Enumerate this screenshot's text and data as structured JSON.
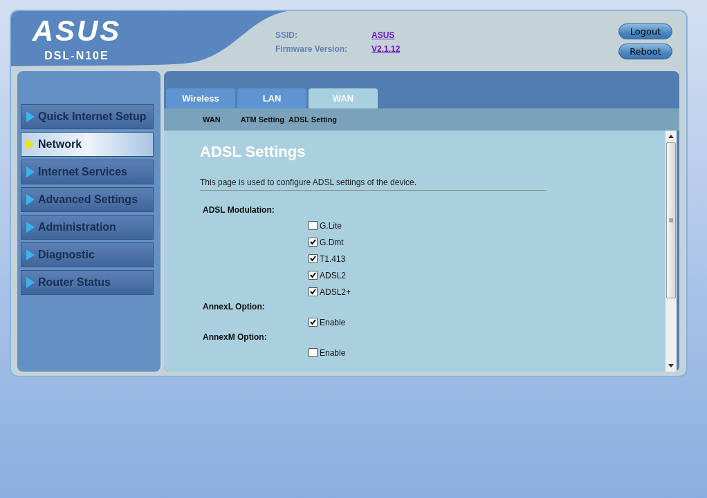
{
  "header": {
    "logo": "ASUS",
    "model": "DSL-N10E",
    "info": [
      {
        "label": "SSID:",
        "value": "ASUS"
      },
      {
        "label": "Firmware Version:",
        "value": "V2.1.12"
      }
    ],
    "buttons": [
      "Logout",
      "Reboot"
    ]
  },
  "sidebar": {
    "items": [
      {
        "label": "Quick Internet Setup",
        "selected": false
      },
      {
        "label": "Network",
        "selected": true
      },
      {
        "label": "Internet Services",
        "selected": false
      },
      {
        "label": "Advanced Settings",
        "selected": false
      },
      {
        "label": "Administration",
        "selected": false
      },
      {
        "label": "Diagnostic",
        "selected": false
      },
      {
        "label": "Router Status",
        "selected": false
      }
    ]
  },
  "tabs": [
    {
      "label": "Wireless",
      "selected": false
    },
    {
      "label": "LAN",
      "selected": false
    },
    {
      "label": "WAN",
      "selected": true
    }
  ],
  "subnav": [
    "WAN",
    "ATM Setting",
    "ADSL Setting"
  ],
  "content": {
    "title": "ADSL Settings",
    "description": "This page is used to configure ADSL settings of the device.",
    "groups": [
      {
        "label": "ADSL Modulation:",
        "options": [
          {
            "label": "G.Lite",
            "checked": false
          },
          {
            "label": "G.Dmt",
            "checked": true
          },
          {
            "label": "T1.413",
            "checked": true
          },
          {
            "label": "ADSL2",
            "checked": true
          },
          {
            "label": "ADSL2+",
            "checked": true
          }
        ]
      },
      {
        "label": "AnnexL Option:",
        "options": [
          {
            "label": "Enable",
            "checked": true
          }
        ]
      },
      {
        "label": "AnnexM Option:",
        "options": [
          {
            "label": "Enable",
            "checked": false
          }
        ]
      }
    ]
  }
}
